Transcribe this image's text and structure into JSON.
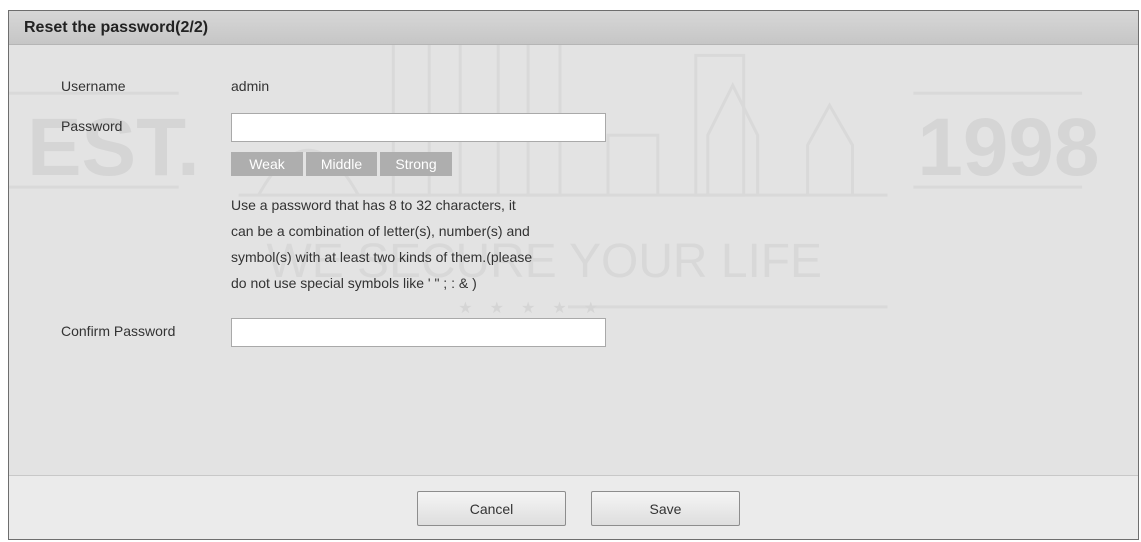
{
  "dialog": {
    "title": "Reset the password(2/2)"
  },
  "form": {
    "username_label": "Username",
    "username_value": "admin",
    "password_label": "Password",
    "password_value": "",
    "confirm_label": "Confirm Password",
    "confirm_value": ""
  },
  "strength_meter": {
    "levels": [
      "Weak",
      "Middle",
      "Strong"
    ],
    "color": "#aeaeae"
  },
  "hint": {
    "lines": [
      "Use a password that has 8 to 32 characters, it",
      "can be a combination of letter(s), number(s) and",
      "symbol(s) with at least two kinds of them.(please",
      "do not use special symbols like ' \" ; : & )"
    ]
  },
  "buttons": {
    "cancel_label": "Cancel",
    "save_label": "Save"
  },
  "watermark": {
    "left_text": "EST.",
    "right_text": "1998",
    "slogan": "WE SECURE YOUR LIFE"
  },
  "colors": {
    "panel_bg": "#e3e3e3",
    "title_bar": "#cfcfcf",
    "footer_bg": "#ebebeb"
  }
}
